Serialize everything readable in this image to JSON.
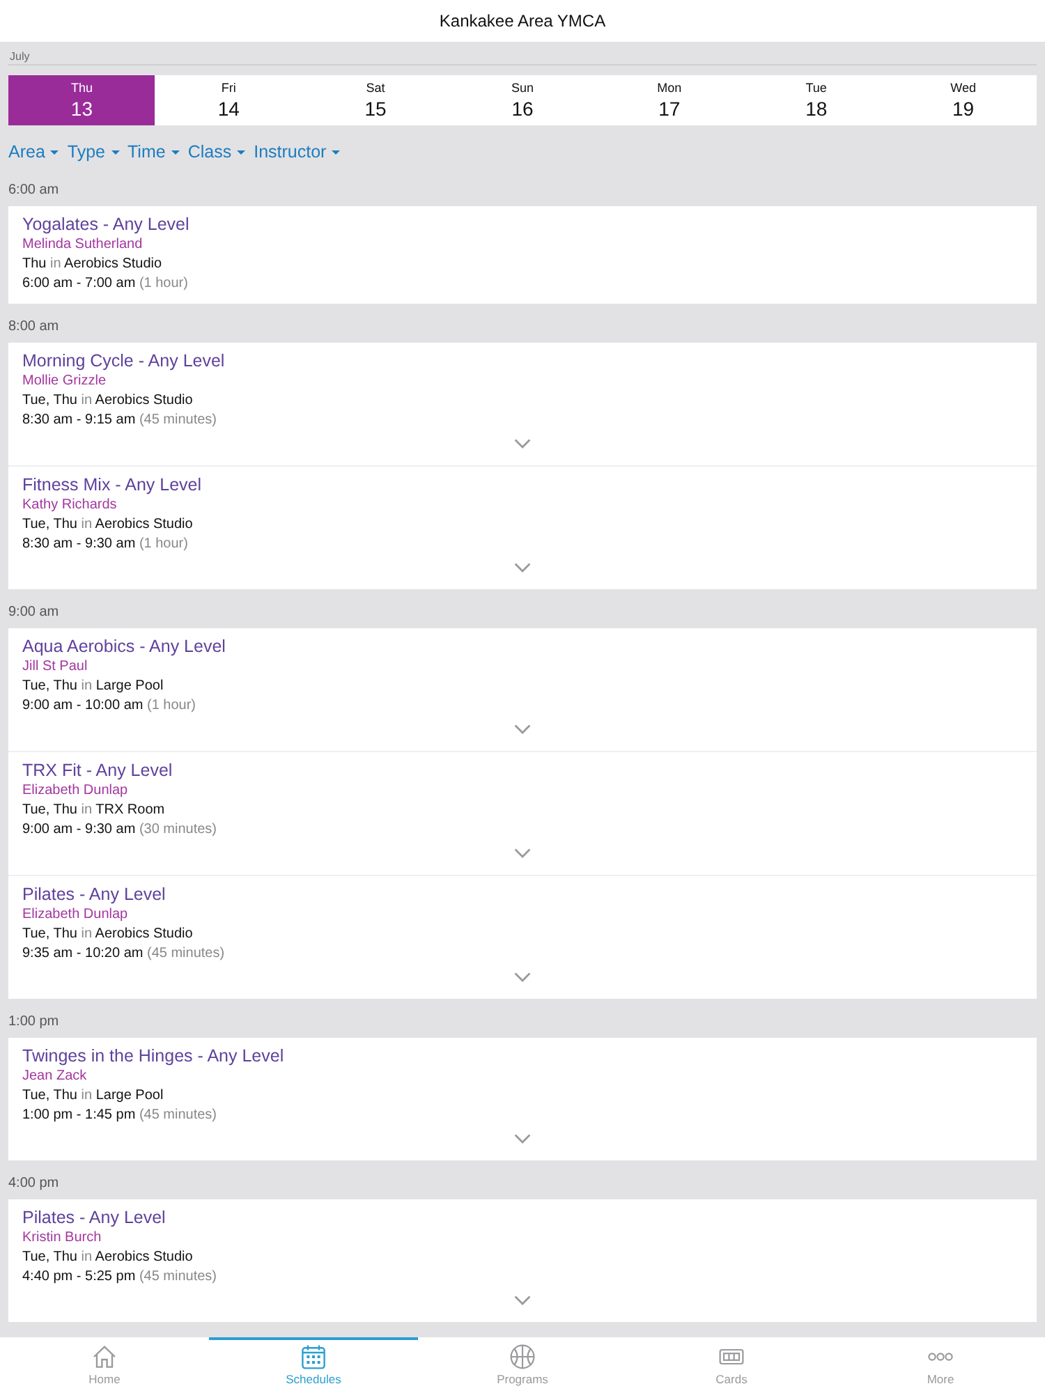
{
  "header": {
    "title": "Kankakee Area YMCA"
  },
  "calendar": {
    "month": "July",
    "days": [
      {
        "weekday": "Thu",
        "date": "13",
        "selected": true
      },
      {
        "weekday": "Fri",
        "date": "14",
        "selected": false
      },
      {
        "weekday": "Sat",
        "date": "15",
        "selected": false
      },
      {
        "weekday": "Sun",
        "date": "16",
        "selected": false
      },
      {
        "weekday": "Mon",
        "date": "17",
        "selected": false
      },
      {
        "weekday": "Tue",
        "date": "18",
        "selected": false
      },
      {
        "weekday": "Wed",
        "date": "19",
        "selected": false
      }
    ]
  },
  "filters": [
    "Area",
    "Type",
    "Time",
    "Class",
    "Instructor"
  ],
  "sections": [
    {
      "time": "6:00 am",
      "classes": [
        {
          "title": "Yogalates - Any Level",
          "instructor": "Melinda Sutherland",
          "days": "Thu",
          "joiner": "in",
          "room": "Aerobics Studio",
          "time": "6:00 am - 7:00 am",
          "duration": "(1 hour)",
          "expandable": false
        }
      ]
    },
    {
      "time": "8:00 am",
      "classes": [
        {
          "title": "Morning Cycle - Any Level",
          "instructor": "Mollie Grizzle",
          "days": "Tue, Thu",
          "joiner": "in",
          "room": "Aerobics Studio",
          "time": "8:30 am - 9:15 am",
          "duration": "(45 minutes)",
          "expandable": true
        },
        {
          "title": "Fitness Mix - Any Level",
          "instructor": "Kathy Richards",
          "days": "Tue, Thu",
          "joiner": "in",
          "room": "Aerobics Studio",
          "time": "8:30 am - 9:30 am",
          "duration": "(1 hour)",
          "expandable": true
        }
      ]
    },
    {
      "time": "9:00 am",
      "classes": [
        {
          "title": "Aqua Aerobics - Any Level",
          "instructor": "Jill St Paul",
          "days": "Tue, Thu",
          "joiner": "in",
          "room": "Large Pool",
          "time": "9:00 am - 10:00 am",
          "duration": "(1 hour)",
          "expandable": true
        },
        {
          "title": "TRX Fit - Any Level",
          "instructor": "Elizabeth Dunlap",
          "days": "Tue, Thu",
          "joiner": "in",
          "room": "TRX Room",
          "time": "9:00 am - 9:30 am",
          "duration": "(30 minutes)",
          "expandable": true
        },
        {
          "title": "Pilates - Any Level",
          "instructor": "Elizabeth Dunlap",
          "days": "Tue, Thu",
          "joiner": "in",
          "room": "Aerobics Studio",
          "time": "9:35 am - 10:20 am",
          "duration": "(45 minutes)",
          "expandable": true
        }
      ]
    },
    {
      "time": "1:00 pm",
      "classes": [
        {
          "title": "Twinges in the Hinges - Any Level",
          "instructor": "Jean Zack",
          "days": "Tue, Thu",
          "joiner": "in",
          "room": "Large Pool",
          "time": "1:00 pm - 1:45 pm",
          "duration": "(45 minutes)",
          "expandable": true
        }
      ]
    },
    {
      "time": "4:00 pm",
      "classes": [
        {
          "title": "Pilates - Any Level",
          "instructor": "Kristin Burch",
          "days": "Tue, Thu",
          "joiner": "in",
          "room": "Aerobics Studio",
          "time": "4:40 pm - 5:25 pm",
          "duration": "(45 minutes)",
          "expandable": true
        }
      ]
    }
  ],
  "tab_bar": [
    {
      "label": "Home",
      "kind": "home",
      "selected": false
    },
    {
      "label": "Schedules",
      "kind": "calendar",
      "selected": true
    },
    {
      "label": "Programs",
      "kind": "ball",
      "selected": false
    },
    {
      "label": "Cards",
      "kind": "card",
      "selected": false
    },
    {
      "label": "More",
      "kind": "more",
      "selected": false
    }
  ]
}
